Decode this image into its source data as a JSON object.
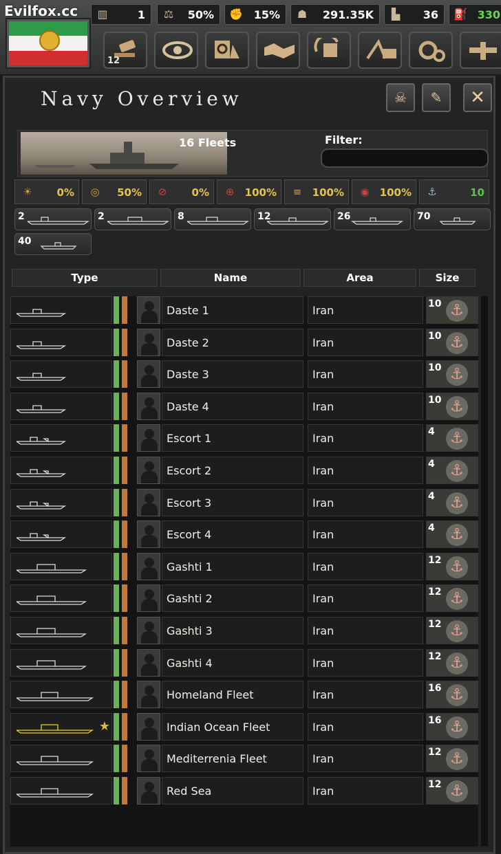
{
  "brand": "Evilfox.cc",
  "topbar": {
    "stats": [
      {
        "icon": "building-icon",
        "value": "1"
      },
      {
        "icon": "scales-icon",
        "value": "50%"
      },
      {
        "icon": "arm-icon",
        "value": "15%"
      },
      {
        "icon": "manpower-icon",
        "value": "291.35K"
      },
      {
        "icon": "factory-icon",
        "value": "36"
      },
      {
        "icon": "fuel-icon",
        "value": "330"
      }
    ],
    "tool_badge": "12"
  },
  "panel": {
    "title": "Navy Overview",
    "fleet_count": "16 Fleets",
    "filter_label": "Filter:",
    "filter_value": ""
  },
  "modifiers": [
    {
      "icon": "sun-ship-icon",
      "value": "0%"
    },
    {
      "icon": "radar-icon",
      "value": "50%"
    },
    {
      "icon": "sinking-ship-icon",
      "value": "0%"
    },
    {
      "icon": "target-icon",
      "value": "100%"
    },
    {
      "icon": "supply-ship-icon",
      "value": "100%"
    },
    {
      "icon": "sea-ship-icon",
      "value": "100%"
    },
    {
      "icon": "anchor-icon",
      "value": "10"
    }
  ],
  "ship_filters": [
    {
      "count": "2",
      "cls": "CV"
    },
    {
      "count": "2",
      "cls": "BB"
    },
    {
      "count": "8",
      "cls": "CA"
    },
    {
      "count": "12",
      "cls": "CL"
    },
    {
      "count": "26",
      "cls": "DD"
    },
    {
      "count": "70",
      "cls": "SS"
    },
    {
      "count": "40",
      "cls": "SS"
    }
  ],
  "columns": {
    "type": "Type",
    "name": "Name",
    "area": "Area",
    "size": "Size"
  },
  "fleets": [
    {
      "name": "Daste 1",
      "area": "Iran",
      "size": "10"
    },
    {
      "name": "Daste 2",
      "area": "Iran",
      "size": "10"
    },
    {
      "name": "Daste 3",
      "area": "Iran",
      "size": "10"
    },
    {
      "name": "Daste 4",
      "area": "Iran",
      "size": "10"
    },
    {
      "name": "Escort 1",
      "area": "Iran",
      "size": "4"
    },
    {
      "name": "Escort 2",
      "area": "Iran",
      "size": "4"
    },
    {
      "name": "Escort 3",
      "area": "Iran",
      "size": "4"
    },
    {
      "name": "Escort 4",
      "area": "Iran",
      "size": "4"
    },
    {
      "name": "Gashti 1",
      "area": "Iran",
      "size": "12"
    },
    {
      "name": "Gashti 2",
      "area": "Iran",
      "size": "12"
    },
    {
      "name": "Gashti 3",
      "area": "Iran",
      "size": "12"
    },
    {
      "name": "Gashti 4",
      "area": "Iran",
      "size": "12"
    },
    {
      "name": "Homeland Fleet",
      "area": "Iran",
      "size": "16"
    },
    {
      "name": "Indian Ocean Fleet",
      "area": "Iran",
      "size": "16"
    },
    {
      "name": "Mediterrenia Fleet",
      "area": "Iran",
      "size": "12"
    },
    {
      "name": "Red Sea",
      "area": "Iran",
      "size": "12"
    }
  ]
}
